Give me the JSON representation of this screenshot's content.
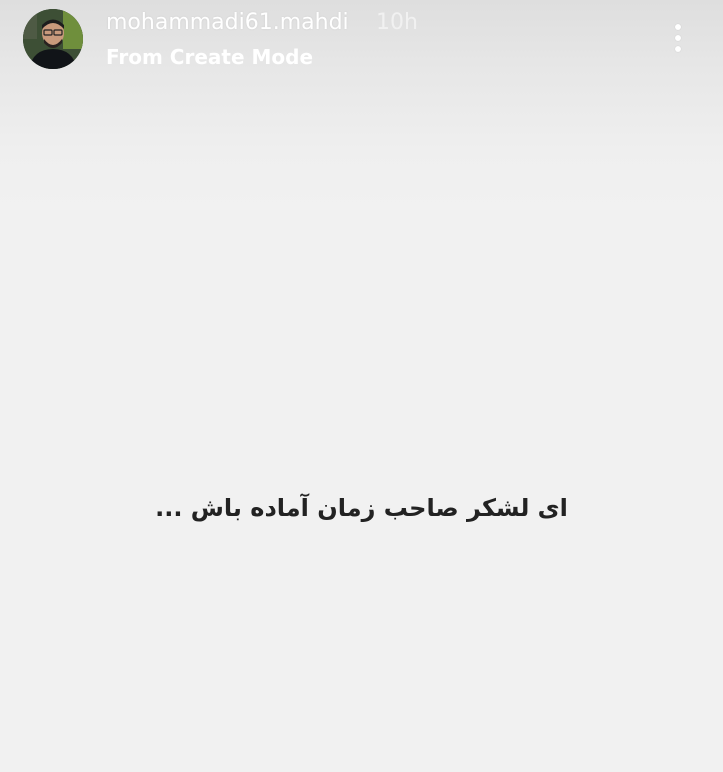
{
  "story": {
    "username": "mohammadi61.mahdi",
    "timestamp": "10h",
    "subtitle": "From Create Mode",
    "caption": "ای لشکر صاحب زمان آماده باش ...",
    "menu_icon": "more-vertical-icon",
    "avatar_icon": "profile-avatar"
  },
  "colors": {
    "header_text": "#ffffff",
    "background": "#f1f1f1",
    "caption_text": "#222222"
  }
}
